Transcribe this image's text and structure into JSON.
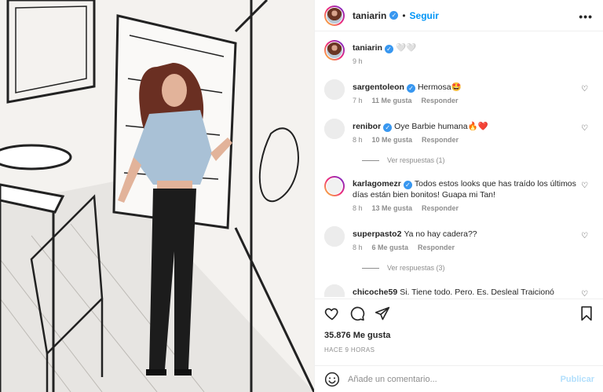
{
  "header": {
    "username": "taniarin",
    "follow_label": "Seguir",
    "separator": "•",
    "more_label": "•••"
  },
  "caption": {
    "username": "taniarin",
    "text": "🤍🤍",
    "time": "9 h"
  },
  "comments": [
    {
      "username": "sargentoleon",
      "verified": true,
      "text": "Hermosa🤩",
      "time": "7 h",
      "likes": "11 Me gusta",
      "reply": "Responder",
      "avatar": "plain"
    },
    {
      "username": "renibor",
      "verified": true,
      "text": "Oye Barbie humana🔥❤️",
      "time": "8 h",
      "likes": "10 Me gusta",
      "reply": "Responder",
      "avatar": "plain",
      "replies": "Ver respuestas (1)"
    },
    {
      "username": "karlagomezr",
      "verified": true,
      "text": "Todos estos looks que has traído los últimos días están bien bonitos! Guapa mi Tan!",
      "time": "8 h",
      "likes": "13 Me gusta",
      "reply": "Responder",
      "avatar": "ring"
    },
    {
      "username": "superpasto2",
      "verified": false,
      "text": "Ya no hay cadera??",
      "time": "8 h",
      "likes": "6 Me gusta",
      "reply": "Responder",
      "avatar": "plain",
      "replies": "Ver respuestas (3)"
    },
    {
      "username": "chicoche59",
      "verified": false,
      "text": "Si. Tiene todo. Pero. Es. Desleal Traicionó",
      "avatar": "plain"
    }
  ],
  "post": {
    "likes": "35.876 Me gusta",
    "posted": "HACE 9 HORAS"
  },
  "comment_box": {
    "placeholder": "Añade un comentario...",
    "publish_label": "Publicar"
  },
  "icons": [
    "heart-icon",
    "comment-icon",
    "share-icon",
    "save-icon",
    "emoji-icon",
    "more-icon"
  ],
  "colors": {
    "link": "#0095f6",
    "verified": "#3897f0",
    "muted": "#8e8e8e",
    "publish_disabled": "#b2dffc"
  }
}
